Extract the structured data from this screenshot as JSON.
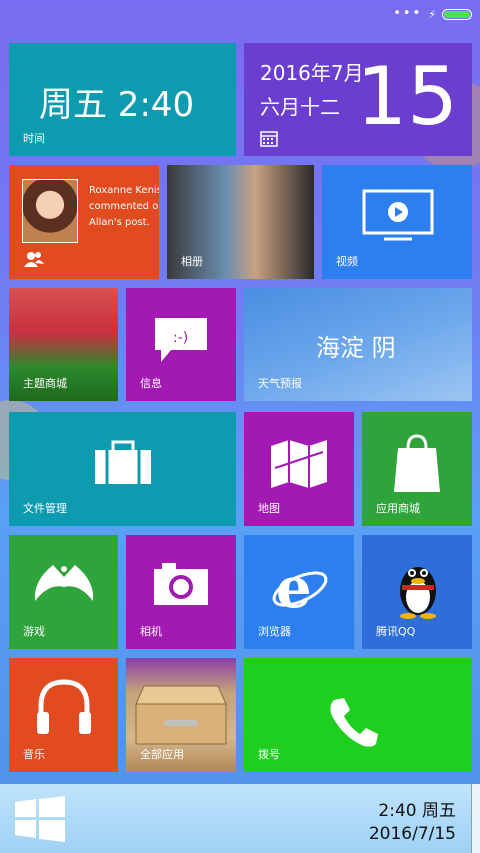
{
  "status": {
    "dots": "•••"
  },
  "tiles": {
    "clock": {
      "day_time": "周五  2:40",
      "label": "时间",
      "color": "#0e9bb0"
    },
    "calendar": {
      "date_line": "2016年7月",
      "lunar": "六月十二",
      "day": "15",
      "color": "#6a3fcf"
    },
    "people": {
      "name": "Roxanne Kenis",
      "line2": "commented o",
      "line3": "Allan's post.",
      "color": "#e24a1f"
    },
    "photos": {
      "label": "相册"
    },
    "video": {
      "label": "视频",
      "color": "#2d7ff0"
    },
    "theme_store": {
      "label": "主题商城"
    },
    "messages": {
      "label": "信息",
      "color": "#a21ab2"
    },
    "weather": {
      "city_condition": "海淀  阴",
      "label": "天气预报"
    },
    "files": {
      "label": "文件管理",
      "color": "#0e9bb0"
    },
    "maps": {
      "label": "地图",
      "color": "#a21ab2"
    },
    "app_store": {
      "label": "应用商城",
      "color": "#2ea43b"
    },
    "games": {
      "label": "游戏",
      "color": "#2ea43b"
    },
    "camera": {
      "label": "相机",
      "color": "#a21ab2"
    },
    "browser": {
      "label": "浏览器",
      "color": "#2d7ff0"
    },
    "qq": {
      "label": "腾讯QQ",
      "color": "#2d6ed8"
    },
    "music": {
      "label": "音乐",
      "color": "#e24a1f"
    },
    "all_apps": {
      "label": "全部应用"
    },
    "dialer": {
      "label": "拨号",
      "color": "#1fcf1f"
    }
  },
  "taskbar": {
    "time": "2:40 周五",
    "date": "2016/7/15"
  }
}
